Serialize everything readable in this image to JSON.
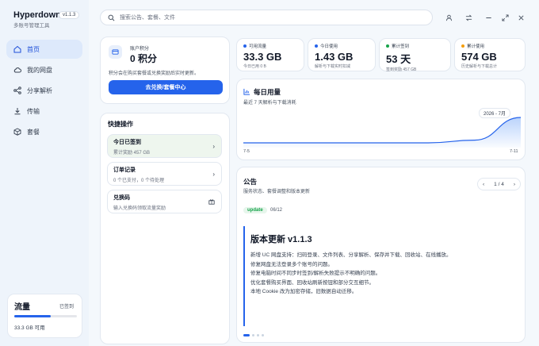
{
  "app": {
    "name": "Hyperdown",
    "version": "v1.1.3",
    "subtitle": "多账号管理工具"
  },
  "sidebar": {
    "items": [
      {
        "label": "首页",
        "icon": "home-icon",
        "active": true
      },
      {
        "label": "我的网盘",
        "icon": "cloud-icon"
      },
      {
        "label": "分享解析",
        "icon": "share-icon"
      },
      {
        "label": "传输",
        "icon": "download-icon"
      },
      {
        "label": "套餐",
        "icon": "package-icon"
      }
    ]
  },
  "flow": {
    "title": "流量",
    "badge": "已签到",
    "value": "33.3 GB 可用",
    "progress": 0.58
  },
  "search": {
    "placeholder": "搜索公告、套餐、文件"
  },
  "account": {
    "label": "账户积分",
    "points": "0 积分",
    "desc": "积分会在购买套餐或兑换奖励后实时更新。",
    "button": "去兑换/套餐中心"
  },
  "stats": [
    {
      "label": "可用流量",
      "value": "33.3 GB",
      "hint": "今日已用 0 B",
      "color": "#2563eb"
    },
    {
      "label": "今日使用",
      "value": "1.43 GB",
      "hint": "解析与下载实时扣减",
      "color": "#2563eb"
    },
    {
      "label": "累计签到",
      "value": "53 天",
      "hint": "签到奖励 457 GB",
      "color": "#16a34a"
    },
    {
      "label": "累计使用",
      "value": "574 GB",
      "hint": "历史解析与下载总计",
      "color": "#f59e0b"
    }
  ],
  "quick": {
    "title": "快捷操作",
    "items": [
      {
        "title": "今日已签到",
        "sub": "累计奖励 457 GB",
        "icon": "chevron-right-icon"
      },
      {
        "title": "订单记录",
        "sub": "0 个已支付，0 个待处理",
        "icon": "chevron-right-icon"
      },
      {
        "title": "兑换码",
        "sub": "输入兑换码领取流量奖励",
        "icon": "gift-icon"
      }
    ]
  },
  "daily": {
    "title": "每日用量",
    "subtitle": "最近 7 天解析与下载消耗",
    "tag": "2026 - 7月",
    "x_start": "7-5",
    "x_end": "7-11"
  },
  "chart_data": {
    "type": "area",
    "x": [
      "7-5",
      "7-6",
      "7-7",
      "7-8",
      "7-9",
      "7-10",
      "7-11"
    ],
    "values": [
      0,
      0,
      0,
      0,
      0,
      0.15,
      1.43
    ],
    "title": "每日用量"
  },
  "notice": {
    "title": "公告",
    "subtitle": "服务状态、套餐调整和版本更新",
    "pager": "1 / 4",
    "tag": "update",
    "date": "06/12",
    "headline": "版本更新 v1.1.3",
    "lines": [
      "新增 UC 网盘支持：扫码登录、文件列表、分享解析、保存并下载、回收站、在线播放。",
      "修复网盘无法登录多个账号的问题。",
      "修复电脑时间不同步时签到/解析失败提示不明确的问题。",
      "优化套餐购买界面、回收站刷新按钮和部分交互细节。",
      "本地 Cookie 改为加密存储，旧数据自动迁移。"
    ]
  }
}
